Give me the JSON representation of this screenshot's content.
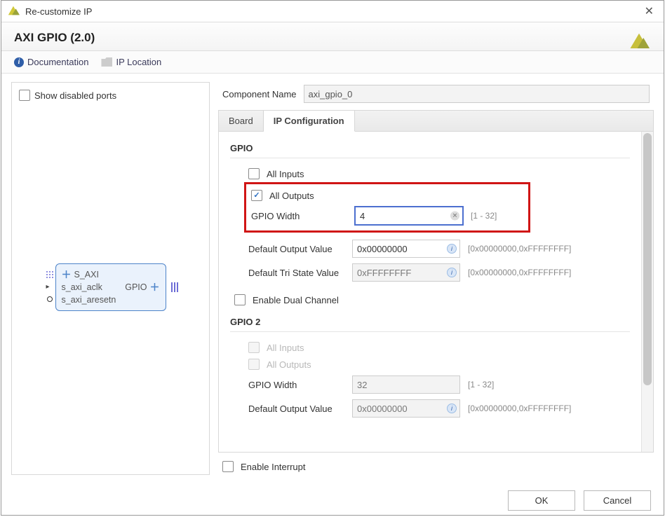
{
  "window": {
    "title": "Re-customize IP",
    "close_glyph": "✕"
  },
  "header": {
    "product_title": "AXI GPIO (2.0)"
  },
  "subbar": {
    "documentation": "Documentation",
    "ip_location": "IP Location"
  },
  "left_panel": {
    "show_disabled_ports_label": "Show disabled ports",
    "block_ports": {
      "s_axi": "S_AXI",
      "aclk": "s_axi_aclk",
      "aresetn": "s_axi_aresetn",
      "gpio": "GPIO"
    }
  },
  "right_panel": {
    "component_name_label": "Component Name",
    "component_name_value": "axi_gpio_0",
    "tabs": {
      "board": "Board",
      "ip_config": "IP Configuration"
    },
    "section_gpio": "GPIO",
    "section_gpio2": "GPIO 2",
    "all_inputs_label": "All Inputs",
    "all_outputs_label": "All Outputs",
    "gpio_width_label": "GPIO Width",
    "gpio_width_value": "4",
    "gpio_width_range": "[1 - 32]",
    "default_output_label": "Default Output Value",
    "default_output_value": "0x00000000",
    "default_output_range": "[0x00000000,0xFFFFFFFF]",
    "default_tri_label": "Default Tri State Value",
    "default_tri_value": "0xFFFFFFFF",
    "default_tri_range": "[0x00000000,0xFFFFFFFF]",
    "enable_dual_label": "Enable Dual Channel",
    "gpio2_width_value": "32",
    "enable_interrupt_label": "Enable Interrupt"
  },
  "buttons": {
    "ok": "OK",
    "cancel": "Cancel"
  }
}
